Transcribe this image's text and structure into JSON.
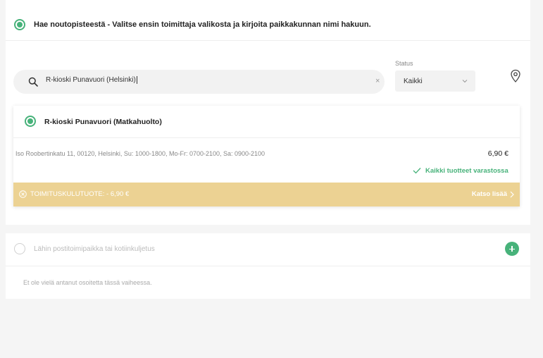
{
  "pickup_option": {
    "title": "Hae noutopisteestä - Valitse ensin toimittaja valikosta ja kirjoita paikkakunnan nimi hakuun.",
    "selected": true
  },
  "search": {
    "value": "R-kioski Punavuori (Helsinki)",
    "clear_symbol": "×"
  },
  "status": {
    "label": "Status",
    "selected": "Kaikki"
  },
  "result": {
    "name": "R-kioski Punavuori (Matkahuolto)",
    "address": "Iso Roobertinkatu 11, 00120, Helsinki, Su: 1000-1800, Mo-Fr: 0700-2100, Sa: 0900-2100",
    "price": "6,90 €",
    "stock": "Kaikki tuotteet varastossa",
    "banner_text": "TOIMITUSKULUTUOTE: - 6,90 €",
    "banner_link": "Katso lisää",
    "colors": {
      "accent": "#47b27a",
      "banner": "#ecd293"
    }
  },
  "home_delivery": {
    "title": "Lähin postitoimipaikka tai kotiinkuljetus",
    "note": "Et ole vielä antanut osoitetta tässä vaiheessa.",
    "selected": false
  }
}
